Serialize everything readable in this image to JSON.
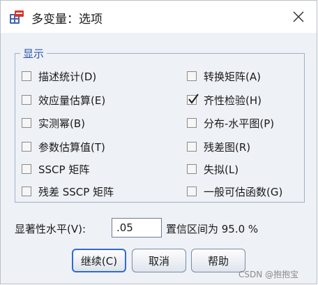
{
  "window": {
    "title": "多变量：选项"
  },
  "display_group": {
    "legend": "显示",
    "options": [
      {
        "label": "描述统计(D)",
        "checked": false
      },
      {
        "label": "效应量估算(E)",
        "checked": false
      },
      {
        "label": "实测幂(B)",
        "checked": false
      },
      {
        "label": "参数估算值(T)",
        "checked": false
      },
      {
        "label": "SSCP 矩阵",
        "checked": false
      },
      {
        "label": "残差 SSCP 矩阵",
        "checked": false
      },
      {
        "label": "转换矩阵(A)",
        "checked": false
      },
      {
        "label": "齐性检验(H)",
        "checked": true
      },
      {
        "label": "分布-水平图(P)",
        "checked": false
      },
      {
        "label": "残差图(R)",
        "checked": false
      },
      {
        "label": "失拟(L)",
        "checked": false
      },
      {
        "label": "一般可估函数(G)",
        "checked": false
      }
    ]
  },
  "significance": {
    "label": "显著性水平(V):",
    "value": ".05",
    "confidence_text": "置信区间为 95.0 %"
  },
  "buttons": {
    "continue": "继续(C)",
    "cancel": "取消",
    "help": "帮助"
  },
  "watermark": "CSDN @抱抱宝",
  "colors": {
    "accent": "#2f6bd1",
    "legend": "#2955a6"
  }
}
